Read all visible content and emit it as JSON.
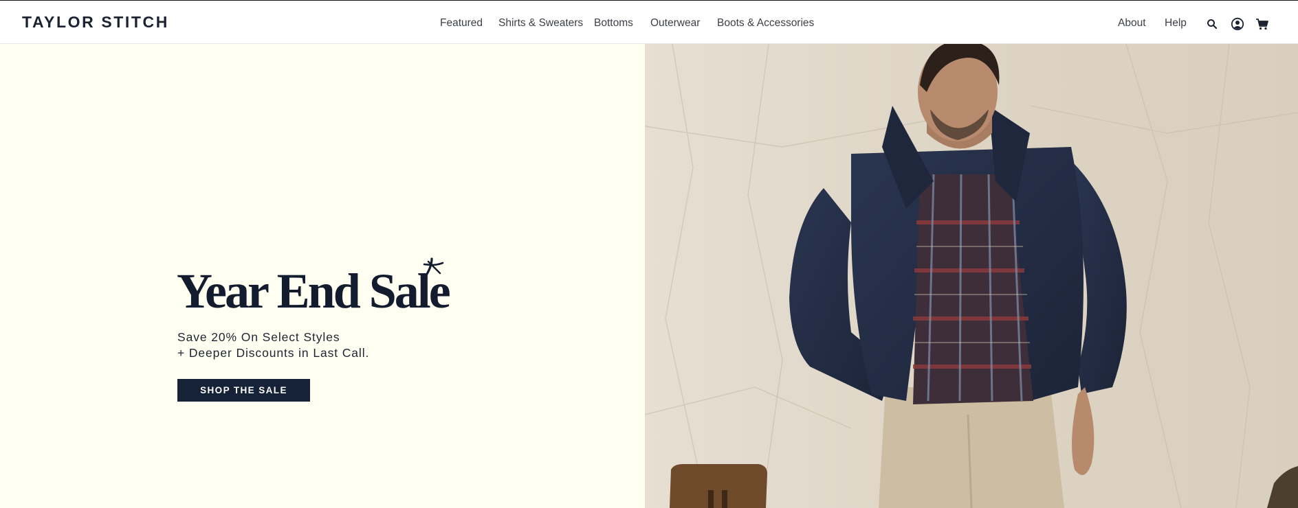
{
  "brand": {
    "logo_text": "TAYLOR STITCH"
  },
  "nav": {
    "items": [
      {
        "label": "Featured"
      },
      {
        "label": "Shirts & Sweaters"
      },
      {
        "label": "Bottoms"
      },
      {
        "label": "Outerwear"
      },
      {
        "label": "Boots & Accessories"
      }
    ]
  },
  "utility_nav": {
    "about_label": "About",
    "help_label": "Help",
    "icons": [
      "search-icon",
      "account-icon",
      "cart-icon"
    ]
  },
  "hero": {
    "title": "Year End Sale",
    "subtitle_line1": "Save 20% On Select Styles",
    "subtitle_line2": "+ Deeper Discounts in Last Call.",
    "cta_label": "SHOP THE SALE",
    "image_subject": "man-in-navy-fleece-jacket-and-plaid-shirt"
  },
  "colors": {
    "navy": "#152237",
    "cream_background": "#fffff2",
    "text_dark": "#1c2230"
  }
}
